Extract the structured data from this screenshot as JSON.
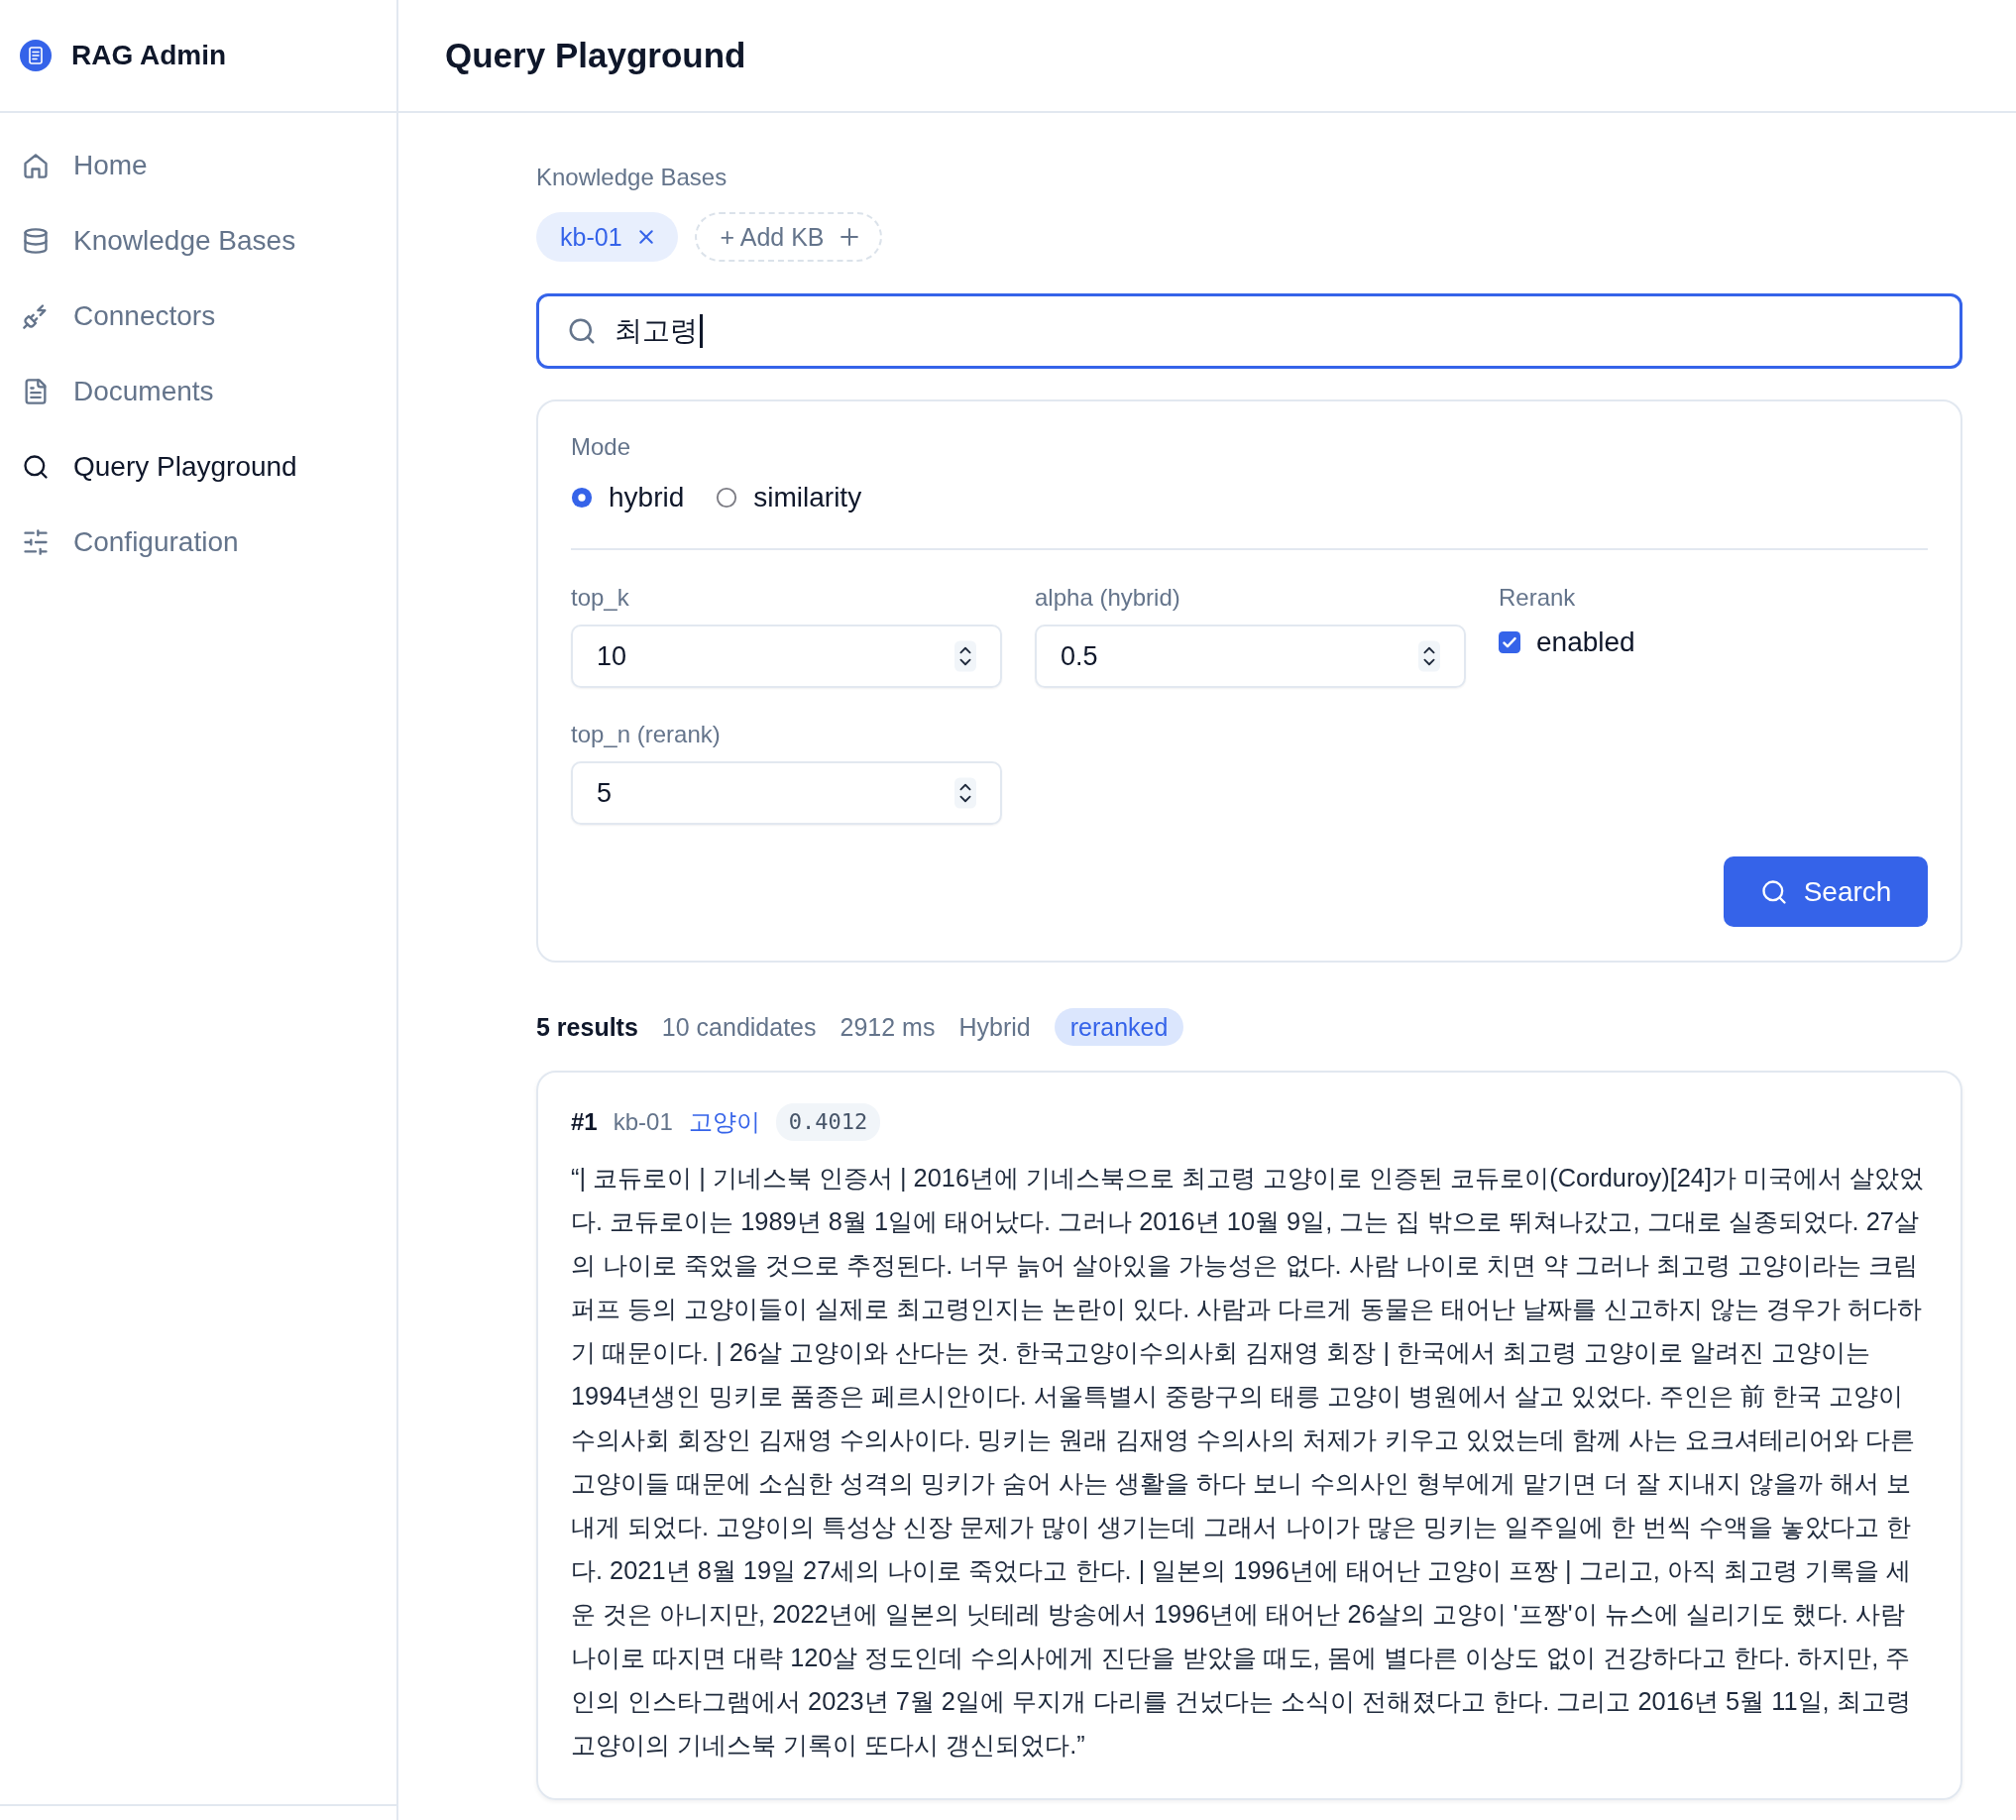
{
  "sidebar": {
    "brand": "RAG Admin",
    "items": [
      {
        "label": "Home",
        "selected": false
      },
      {
        "label": "Knowledge Bases",
        "selected": false
      },
      {
        "label": "Connectors",
        "selected": false
      },
      {
        "label": "Documents",
        "selected": false
      },
      {
        "label": "Query Playground",
        "selected": true
      },
      {
        "label": "Configuration",
        "selected": false
      }
    ]
  },
  "header": {
    "title": "Query Playground"
  },
  "knowledge_bases": {
    "label": "Knowledge Bases",
    "chips": [
      {
        "label": "kb-01"
      }
    ],
    "add_button": "+ Add KB"
  },
  "search": {
    "value": "최고령",
    "focused": true
  },
  "params": {
    "mode": {
      "label": "Mode",
      "options": [
        {
          "label": "hybrid",
          "selected": true
        },
        {
          "label": "similarity",
          "selected": false
        }
      ]
    },
    "fields": [
      {
        "label": "top_k",
        "value": "10"
      },
      {
        "label": "alpha (hybrid)",
        "value": "0.5"
      },
      {
        "label": "top_n (rerank)",
        "value": "5"
      }
    ],
    "rerank": {
      "label": "Rerank",
      "option": "enabled",
      "checked": true
    },
    "submit": "Search"
  },
  "summary": [
    {
      "kind": "count",
      "text": "5 results"
    },
    {
      "kind": "meta",
      "text": "10 candidates"
    },
    {
      "kind": "meta",
      "text": "2912 ms"
    },
    {
      "kind": "meta",
      "text": "Hybrid"
    },
    {
      "kind": "badge",
      "text": "reranked"
    }
  ],
  "results": [
    {
      "rank": "#1",
      "kb": "kb-01",
      "document": "고양이",
      "score": "0.4012",
      "text": "“| 코듀로이 | 기네스북 인증서 | 2016년에 기네스북으로 최고령 고양이로 인증된 코듀로이(Corduroy)[24]가 미국에서 살았었다. 코듀로이는 1989년 8월 1일에 태어났다. 그러나 2016년 10월 9일, 그는 집 밖으로 뛰쳐나갔고, 그대로 실종되었다. 27살의 나이로 죽었을 것으로 추정된다. 너무 늙어 살아있을 가능성은 없다. 사람 나이로 치면 약 그러나 최고령 고양이라는 크림 퍼프 등의 고양이들이 실제로 최고령인지는 논란이 있다. 사람과 다르게 동물은 태어난 날짜를 신고하지 않는 경우가 허다하기 때문이다. | 26살 고양이와 산다는 것. 한국고양이수의사회 김재영 회장 | 한국에서 최고령 고양이로 알려진 고양이는 1994년생인 밍키로 품종은 페르시안이다. 서울특별시 중랑구의 태릉 고양이 병원에서 살고 있었다. 주인은 前 한국 고양이 수의사회 회장인 김재영 수의사이다. 밍키는 원래 김재영 수의사의 처제가 키우고 있었는데 함께 사는 요크셔테리어와 다른 고양이들 때문에 소심한 성격의 밍키가 숨어 사는 생활을 하다 보니 수의사인 형부에게 맡기면 더 잘 지내지 않을까 해서 보내게 되었다. 고양이의 특성상 신장 문제가 많이 생기는데 그래서 나이가 많은 밍키는 일주일에 한 번씩 수액을 놓았다고 한다. 2021년 8월 19일 27세의 나이로 죽었다고 한다. | 일본의 1996년에 태어난 고양이 프짱 | 그리고, 아직 최고령 기록을 세운 것은 아니지만, 2022년에 일본의 닛테레 방송에서 1996년에 태어난 26살의 고양이 '프짱'이 뉴스에 실리기도 했다. 사람 나이로 따지면 대략 120살 정도인데 수의사에게 진단을 받았을 때도, 몸에 별다른 이상도 없이 건강하다고 한다. 하지만, 주인의 인스타그램에서 2023년 7월 2일에 무지개 다리를 건넜다는 소식이 전해졌다고 한다. 그리고 2016년 5월 11일, 최고령 고양이의 기네스북 기록이 또다시 갱신되었다.”"
    }
  ]
}
